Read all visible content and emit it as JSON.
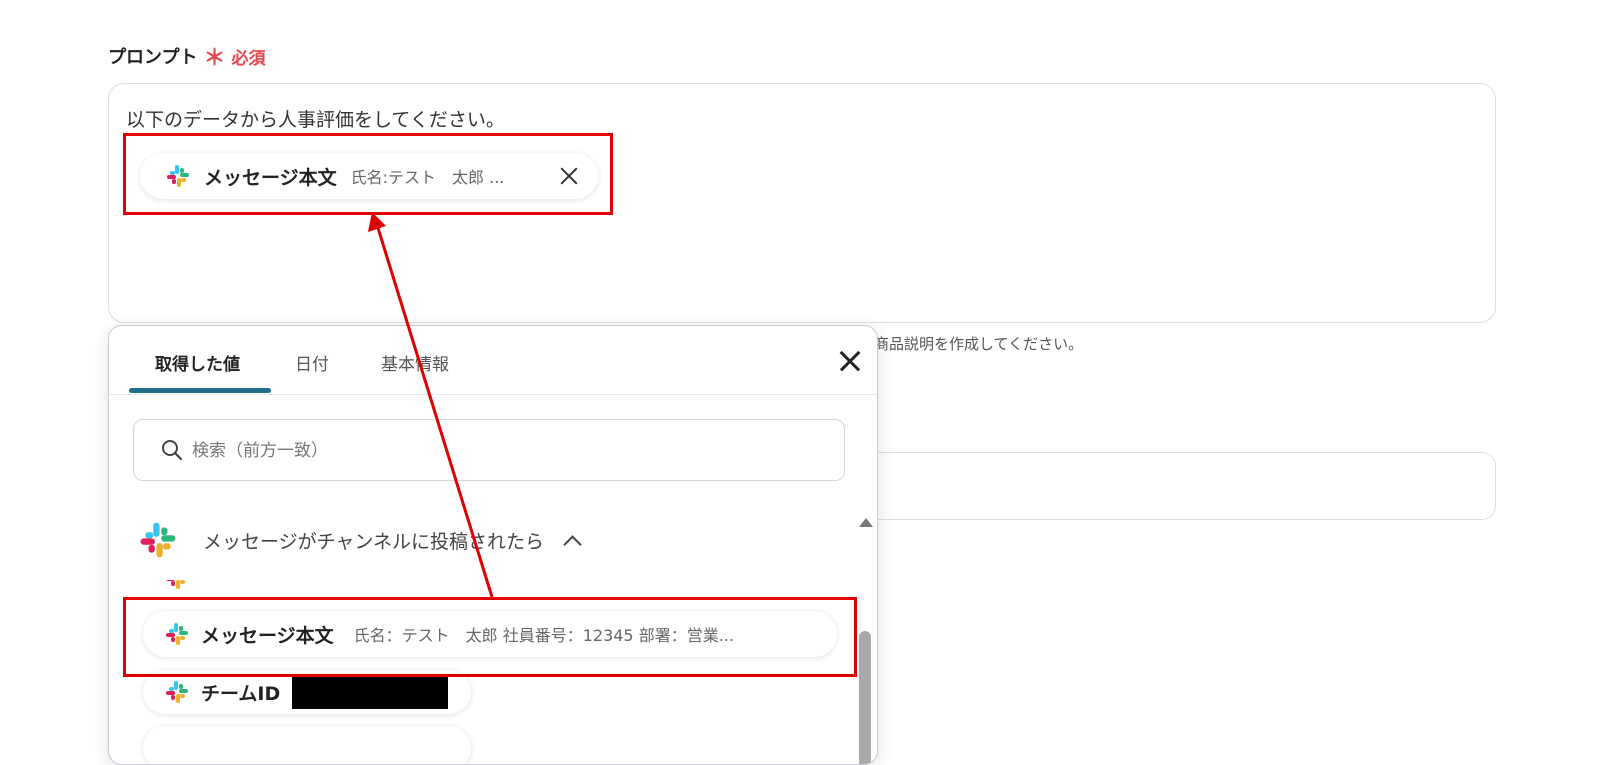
{
  "field": {
    "label": "プロンプト",
    "asterisk": "＊",
    "required": "必須"
  },
  "prompt": {
    "text": "以下のデータから人事評価をしてください。",
    "chip": {
      "label": "メッセージ本文",
      "value": "氏名:テスト　太郎 ..."
    }
  },
  "hint": "商品説明を作成してください。",
  "dropdown": {
    "tabs": [
      {
        "label": "取得した値",
        "active": true
      },
      {
        "label": "日付",
        "active": false
      },
      {
        "label": "基本情報",
        "active": false
      }
    ],
    "search_placeholder": "検索（前方一致）",
    "group_title": "メッセージがチャンネルに投稿されたら",
    "items": [
      {
        "label": "メッセージ本文",
        "value": "氏名：テスト　太郎 社員番号：12345 部署：営業..."
      },
      {
        "label": "チームID",
        "value": ""
      }
    ]
  },
  "icons": {
    "chip_icon": "slack-icon",
    "close_icon": "close-icon",
    "search_icon": "search-icon",
    "chevron_icon": "chevron-up-icon"
  },
  "colors": {
    "required": "#e5484d",
    "highlight": "#e00000",
    "tab_underline": "#1f6f8b",
    "slack_blue": "#36c5f0",
    "slack_green": "#2eb67d",
    "slack_red": "#e01e5a",
    "slack_yellow": "#ecb22e"
  }
}
